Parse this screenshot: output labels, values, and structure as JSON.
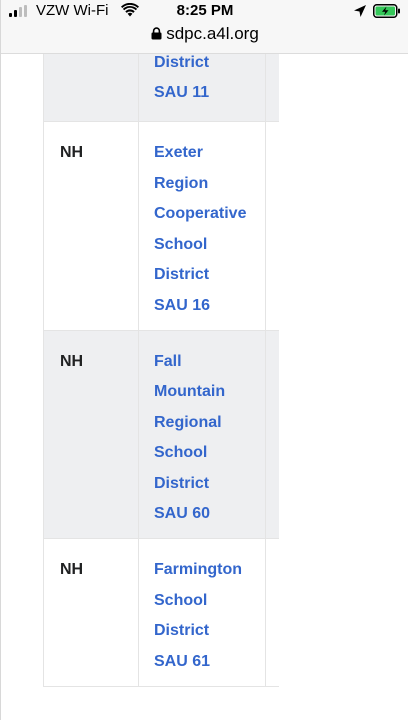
{
  "status_bar": {
    "carrier": "VZW Wi-Fi",
    "time": "8:25 PM",
    "signal_bars": 2,
    "battery_charging": true
  },
  "url_bar": {
    "url": "sdpc.a4l.org"
  },
  "colors": {
    "link": "#3366cc",
    "row_shaded": "#eeeff1",
    "battery_green": "#34c759"
  },
  "table": {
    "rows": [
      {
        "state": "",
        "district_lines": [
          "District",
          "SAU 11"
        ],
        "shaded": true
      },
      {
        "state": "NH",
        "district_lines": [
          "Exeter",
          "Region",
          "Cooperative",
          "School",
          "District",
          "SAU 16"
        ],
        "shaded": false
      },
      {
        "state": "NH",
        "district_lines": [
          "Fall",
          "Mountain",
          "Regional",
          "School",
          "District",
          "SAU 60"
        ],
        "shaded": true
      },
      {
        "state": "NH",
        "district_lines": [
          "Farmington",
          "School",
          "District",
          "SAU 61"
        ],
        "shaded": false
      }
    ]
  }
}
